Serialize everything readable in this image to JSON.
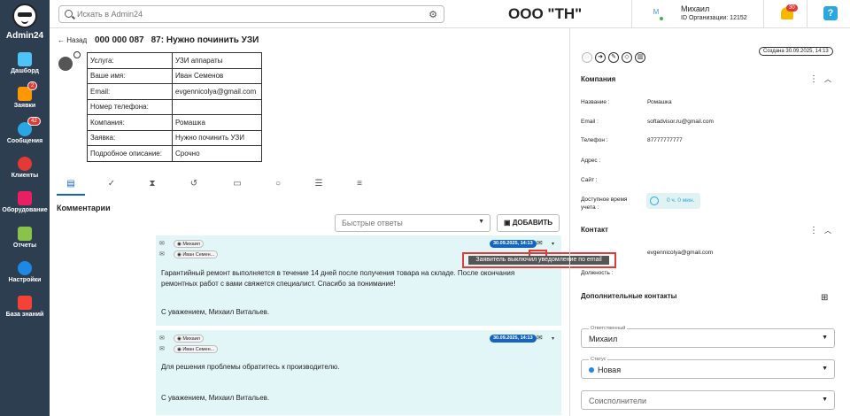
{
  "app": {
    "name": "Admin24"
  },
  "sidebar": {
    "items": [
      {
        "label": "Дашборд",
        "icon": "dashboard-icon",
        "color": "#4fc3f7"
      },
      {
        "label": "Заявки",
        "icon": "requests-icon",
        "color": "#ff9800",
        "badge": "2"
      },
      {
        "label": "Сообщения",
        "icon": "messages-icon",
        "color": "#2aa6e0",
        "badge": "42"
      },
      {
        "label": "Клиенты",
        "icon": "clients-icon",
        "color": "#e53935"
      },
      {
        "label": "Оборудование",
        "icon": "equipment-icon",
        "color": "#e91e63"
      },
      {
        "label": "Отчеты",
        "icon": "reports-icon",
        "color": "#8bc34a"
      },
      {
        "label": "Настройки",
        "icon": "settings-icon",
        "color": "#1e88e5"
      },
      {
        "label": "База знаний",
        "icon": "knowledge-icon",
        "color": "#f44336"
      }
    ]
  },
  "topbar": {
    "search_placeholder": "Искать в Admin24",
    "org": "ООО \"ТН\"",
    "user": "Михаил",
    "user_initial": "M",
    "org_id": "ID Организации: 12152",
    "notif": "30",
    "help": "?"
  },
  "ticket": {
    "back": "Назад",
    "number": "000 000 087",
    "title": "87: Нужно починить УЗИ",
    "rows": [
      {
        "k": "Услуга:",
        "v": "УЗИ аппараты"
      },
      {
        "k": "Ваше имя:",
        "v": "Иван Семенов"
      },
      {
        "k": "Email:",
        "v": "evgennicolya@gmail.com"
      },
      {
        "k": "Номер телефона:",
        "v": ""
      },
      {
        "k": "Компания:",
        "v": "Ромашка"
      },
      {
        "k": "Заявка:",
        "v": "Нужно починить УЗИ"
      },
      {
        "k": "Подробное описание:",
        "v": "Срочно"
      }
    ]
  },
  "comments": {
    "heading": "Комментарии",
    "quick_replies": "Быстрые ответы",
    "add_button": "ДОБАВИТЬ",
    "tooltip": "Заявитель выключил уведомление по email",
    "items": [
      {
        "author": "Михаил",
        "to": "Иван Семен...",
        "date": "30.09.2025, 14:13",
        "text": "Гарантийный ремонт выполняется в течение 14 дней после получения товара на складе. После окончания ремонтных работ с вами свяжется специалист. Спасибо за понимание!",
        "sign": "С уважением, Михаил Витальев."
      },
      {
        "author": "Михаил",
        "to": "Иван Семен...",
        "date": "30.09.2025, 14:13",
        "text": "Для решения проблемы обратитесь к производителю.",
        "sign": "С уважением, Михаил Витальев."
      }
    ]
  },
  "right": {
    "created": "Создана 30.09.2025, 14:13",
    "company": {
      "heading": "Компания",
      "name_l": "Название :",
      "name": "Ромашка",
      "email_l": "Email :",
      "email": "softadvisor.ru@gmail.com",
      "phone_l": "Телефон :",
      "phone": "87777777777",
      "addr_l": "Адрес :",
      "site_l": "Сайт :",
      "time_l": "Доступное время учета :",
      "time": "0 ч. 0 мин."
    },
    "contact": {
      "heading": "Контакт",
      "email": "evgennicolya@gmail.com",
      "pos_l": "Должность :"
    },
    "extra": "Дополнительные контакты",
    "resp": {
      "label": "Ответственный",
      "value": "Михаил"
    },
    "status": {
      "label": "Статус",
      "value": "Новая"
    },
    "co": {
      "value": "Соисполнители"
    }
  }
}
